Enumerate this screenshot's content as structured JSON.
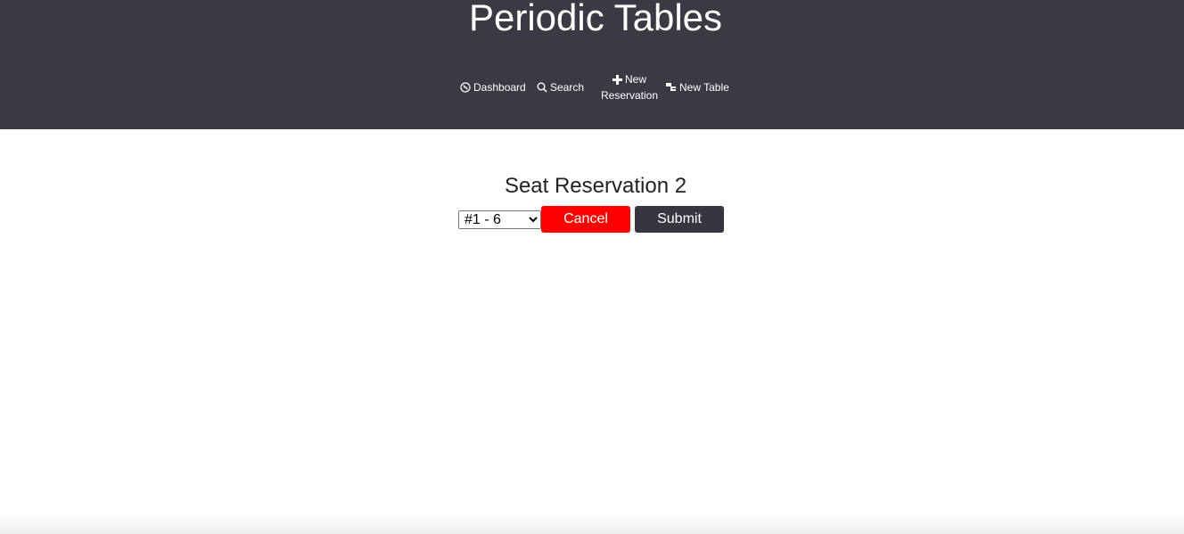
{
  "app": {
    "title": "Periodic Tables"
  },
  "nav": {
    "dashboard": {
      "label": "Dashboard",
      "icon": "dashboard-icon"
    },
    "search": {
      "label": "Search",
      "icon": "search-icon"
    },
    "new_reservation": {
      "label_line1": "New",
      "label_line2": "Reservation",
      "icon": "plus-icon"
    },
    "new_table": {
      "label": "New Table",
      "icon": "table-icon"
    }
  },
  "page": {
    "title": "Seat Reservation 2"
  },
  "form": {
    "table_select": {
      "selected": "#1 - 6",
      "options": [
        "#1 - 6"
      ]
    },
    "cancel_label": "Cancel",
    "submit_label": "Submit"
  },
  "colors": {
    "header_bg": "#3a3a44",
    "cancel_bg": "#ff0000",
    "submit_bg": "#363641",
    "text_on_dark": "#ffffff"
  }
}
